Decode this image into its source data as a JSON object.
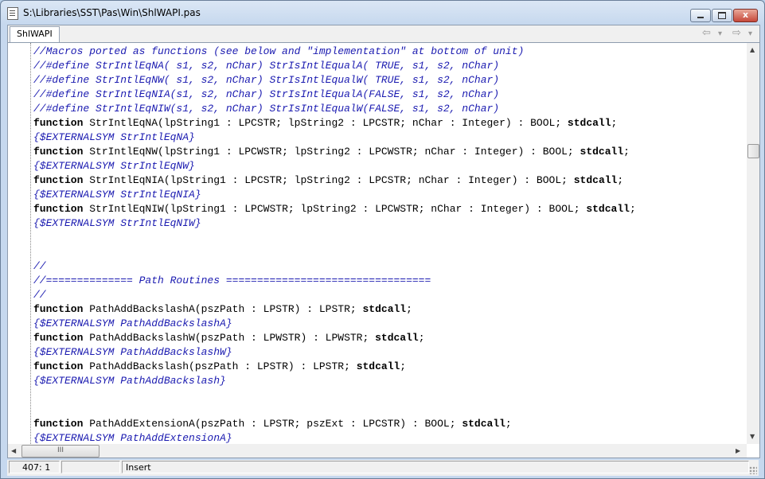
{
  "window": {
    "title": "S:\\Libraries\\SST\\Pas\\Win\\ShlWAPI.pas",
    "minimize_glyph": "",
    "maximize_glyph": "",
    "close_glyph": "x"
  },
  "tabs": [
    {
      "label": "ShlWAPI"
    }
  ],
  "nav": {
    "back": "⇦",
    "back_drop": "▾",
    "forward": "⇨",
    "forward_drop": "▾"
  },
  "editor": {
    "lines": [
      [
        {
          "t": "//Macros ported as functions (see below and \"implementation\" at bottom of unit)",
          "c": "cmt"
        }
      ],
      [
        {
          "t": "//#define StrIntlEqNA( s1, s2, nChar) StrIsIntlEqualA( TRUE, s1, s2, nChar)",
          "c": "cmt"
        }
      ],
      [
        {
          "t": "//#define StrIntlEqNW( s1, s2, nChar) StrIsIntlEqualW( TRUE, s1, s2, nChar)",
          "c": "cmt"
        }
      ],
      [
        {
          "t": "//#define StrIntlEqNIA(s1, s2, nChar) StrIsIntlEqualA(FALSE, s1, s2, nChar)",
          "c": "cmt"
        }
      ],
      [
        {
          "t": "//#define StrIntlEqNIW(s1, s2, nChar) StrIsIntlEqualW(FALSE, s1, s2, nChar)",
          "c": "cmt"
        }
      ],
      [
        {
          "t": "function",
          "c": "kw"
        },
        {
          "t": " StrIntlEqNA(lpString1 : LPCSTR; lpString2 : LPCSTR; nChar : Integer) : BOOL; ",
          "c": ""
        },
        {
          "t": "stdcall",
          "c": "kw"
        },
        {
          "t": ";",
          "c": ""
        }
      ],
      [
        {
          "t": "{$EXTERNALSYM StrIntlEqNA}",
          "c": "cmt"
        }
      ],
      [
        {
          "t": "function",
          "c": "kw"
        },
        {
          "t": " StrIntlEqNW(lpString1 : LPCWSTR; lpString2 : LPCWSTR; nChar : Integer) : BOOL; ",
          "c": ""
        },
        {
          "t": "stdcall",
          "c": "kw"
        },
        {
          "t": ";",
          "c": ""
        }
      ],
      [
        {
          "t": "{$EXTERNALSYM StrIntlEqNW}",
          "c": "cmt"
        }
      ],
      [
        {
          "t": "function",
          "c": "kw"
        },
        {
          "t": " StrIntlEqNIA(lpString1 : LPCSTR; lpString2 : LPCSTR; nChar : Integer) : BOOL; ",
          "c": ""
        },
        {
          "t": "stdcall",
          "c": "kw"
        },
        {
          "t": ";",
          "c": ""
        }
      ],
      [
        {
          "t": "{$EXTERNALSYM StrIntlEqNIA}",
          "c": "cmt"
        }
      ],
      [
        {
          "t": "function",
          "c": "kw"
        },
        {
          "t": " StrIntlEqNIW(lpString1 : LPCWSTR; lpString2 : LPCWSTR; nChar : Integer) : BOOL; ",
          "c": ""
        },
        {
          "t": "stdcall",
          "c": "kw"
        },
        {
          "t": ";",
          "c": ""
        }
      ],
      [
        {
          "t": "{$EXTERNALSYM StrIntlEqNIW}",
          "c": "cmt"
        }
      ],
      [],
      [],
      [
        {
          "t": "//",
          "c": "cmt"
        }
      ],
      [
        {
          "t": "//============== Path Routines =================================",
          "c": "cmt"
        }
      ],
      [
        {
          "t": "//",
          "c": "cmt"
        }
      ],
      [
        {
          "t": "function",
          "c": "kw"
        },
        {
          "t": " PathAddBackslashA(pszPath : LPSTR) : LPSTR; ",
          "c": ""
        },
        {
          "t": "stdcall",
          "c": "kw"
        },
        {
          "t": ";",
          "c": ""
        }
      ],
      [
        {
          "t": "{$EXTERNALSYM PathAddBackslashA}",
          "c": "cmt"
        }
      ],
      [
        {
          "t": "function",
          "c": "kw"
        },
        {
          "t": " PathAddBackslashW(pszPath : LPWSTR) : LPWSTR; ",
          "c": ""
        },
        {
          "t": "stdcall",
          "c": "kw"
        },
        {
          "t": ";",
          "c": ""
        }
      ],
      [
        {
          "t": "{$EXTERNALSYM PathAddBackslashW}",
          "c": "cmt"
        }
      ],
      [
        {
          "t": "function",
          "c": "kw"
        },
        {
          "t": " PathAddBackslash(pszPath : LPSTR) : LPSTR; ",
          "c": ""
        },
        {
          "t": "stdcall",
          "c": "kw"
        },
        {
          "t": ";",
          "c": ""
        }
      ],
      [
        {
          "t": "{$EXTERNALSYM PathAddBackslash}",
          "c": "cmt"
        }
      ],
      [],
      [],
      [
        {
          "t": "function",
          "c": "kw"
        },
        {
          "t": " PathAddExtensionA(pszPath : LPSTR; pszExt : LPCSTR) : BOOL; ",
          "c": ""
        },
        {
          "t": "stdcall",
          "c": "kw"
        },
        {
          "t": ";",
          "c": ""
        }
      ],
      [
        {
          "t": "{$EXTERNALSYM PathAddExtensionA}",
          "c": "cmt"
        }
      ]
    ],
    "scroll_up_glyph": "▲",
    "scroll_down_glyph": "▼",
    "scroll_left_glyph": "◀",
    "scroll_right_glyph": "▶",
    "hthumb_grip": "III"
  },
  "status": {
    "position": "407:  1",
    "modified": "",
    "mode": "Insert"
  },
  "colors": {
    "comment": "#1a1ab0",
    "text": "#000000",
    "close_button": "#c6483a"
  }
}
